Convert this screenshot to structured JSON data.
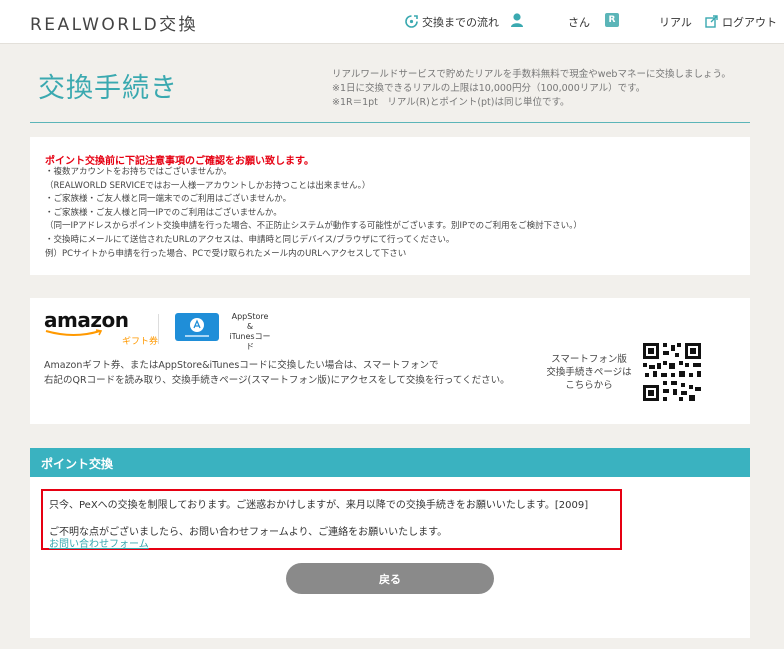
{
  "header": {
    "logo_text": "REALWORLD交換",
    "flow_label": "交換までの流れ",
    "user_suffix": "さん",
    "real_badge": "R",
    "real_label": "リアル",
    "logout_label": "ログアウト"
  },
  "title": {
    "heading": "交換手続き",
    "desc_lines": [
      "リアルワールドサービスで貯めたリアルを手数料無料で現金やwebマネーに交換しましょう。",
      "※1日に交換できるリアルの上限は10,000円分（100,000リアル）です。",
      "※1R＝1pt　リアル(R)とポイント(pt)は同じ単位です。"
    ]
  },
  "notice": {
    "head": "ポイント交換前に下記注意事項のご確認をお願い致します。",
    "lines": [
      "・複数アカウントをお持ちではございませんか。",
      "（REALWORLD SERVICEではお一人様一アカウントしかお持つことは出来ません。）",
      "・ご家族様・ご友人様と同一端末でのご利用はございませんか。",
      "・ご家族様・ご友人様と同一IPでのご利用はございませんか。",
      "（同一IPアドレスからポイント交換申請を行った場合、不正防止システムが動作する可能性がございます。別IPでのご利用をご検討下さい。）",
      "・交換時にメールにて送信されたURLのアクセスは、申請時と同じデバイス/ブラウザにて行ってください。",
      "例）PCサイトから申請を行った場合、PCで受け取られたメール内のURLへアクセスして下さい"
    ]
  },
  "amazon": {
    "logo_word": "amazon",
    "gift_label": "ギフト券",
    "appstore_lines": [
      "AppStore",
      "&",
      "iTunesコード"
    ],
    "desc_lines": [
      "Amazonギフト券、またはAppStore&iTunesコードに交換したい場合は、スマートフォンで",
      "右記のQRコードを読み取り、交換手続きページ(スマートフォン版)にアクセスをして交換を行ってください。"
    ],
    "qr_label_lines": [
      "スマートフォン版",
      "交換手続きページは",
      "こちらから"
    ]
  },
  "point": {
    "section_title": "ポイント交換",
    "alert_line1": "只今、PeXへの交換を制限しております。ご迷惑おかけしますが、来月以降での交換手続きをお願いいたします。[2009]",
    "alert_line2": "ご不明な点がございましたら、お問い合わせフォームより、ご連絡をお願いいたします。",
    "alert_link": "お問い合わせフォーム",
    "back_label": "戻る"
  },
  "colors": {
    "accent": "#3ab2c0",
    "alert": "#e60012",
    "button": "#8a8a8a"
  }
}
